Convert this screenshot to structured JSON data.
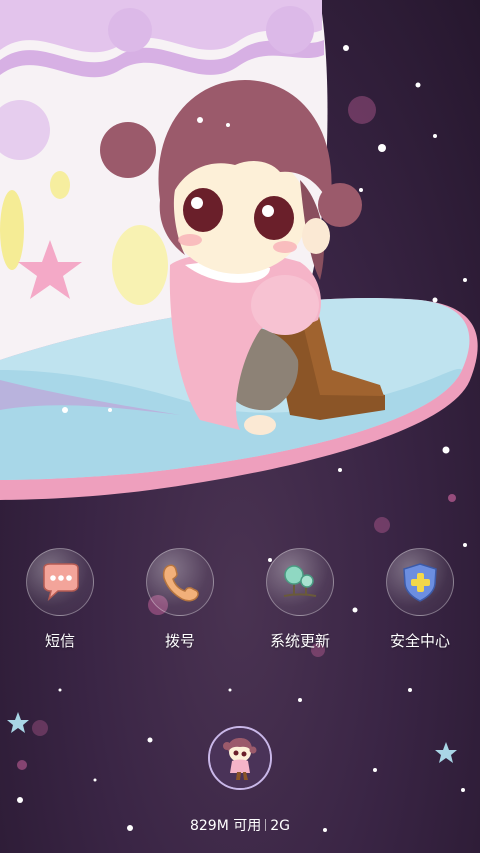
{
  "apps": [
    {
      "label": "短信",
      "icon": "message-bubble-icon"
    },
    {
      "label": "拨号",
      "icon": "phone-handset-icon"
    },
    {
      "label": "系统更新",
      "icon": "tree-update-icon"
    },
    {
      "label": "安全中心",
      "icon": "shield-plus-icon"
    }
  ],
  "dock": {
    "avatar_icon": "girl-avatar-icon"
  },
  "status": {
    "memory": "829M 可用",
    "network": "2G"
  },
  "colors": {
    "background": "#3a2545",
    "moon_white": "#f6f1f4",
    "moon_stripe": "#d9b3e6",
    "ring_blue": "#c8e8f2",
    "ring_pink": "#f0a9c4",
    "hair": "#9a5a68",
    "boot": "#8a5424",
    "cardigan": "#f6b6c9",
    "shield_blue": "#6c8ee0",
    "plus_yellow": "#f2d74a",
    "phone_orange": "#f2b07a",
    "message_pink": "#f3a49a"
  }
}
